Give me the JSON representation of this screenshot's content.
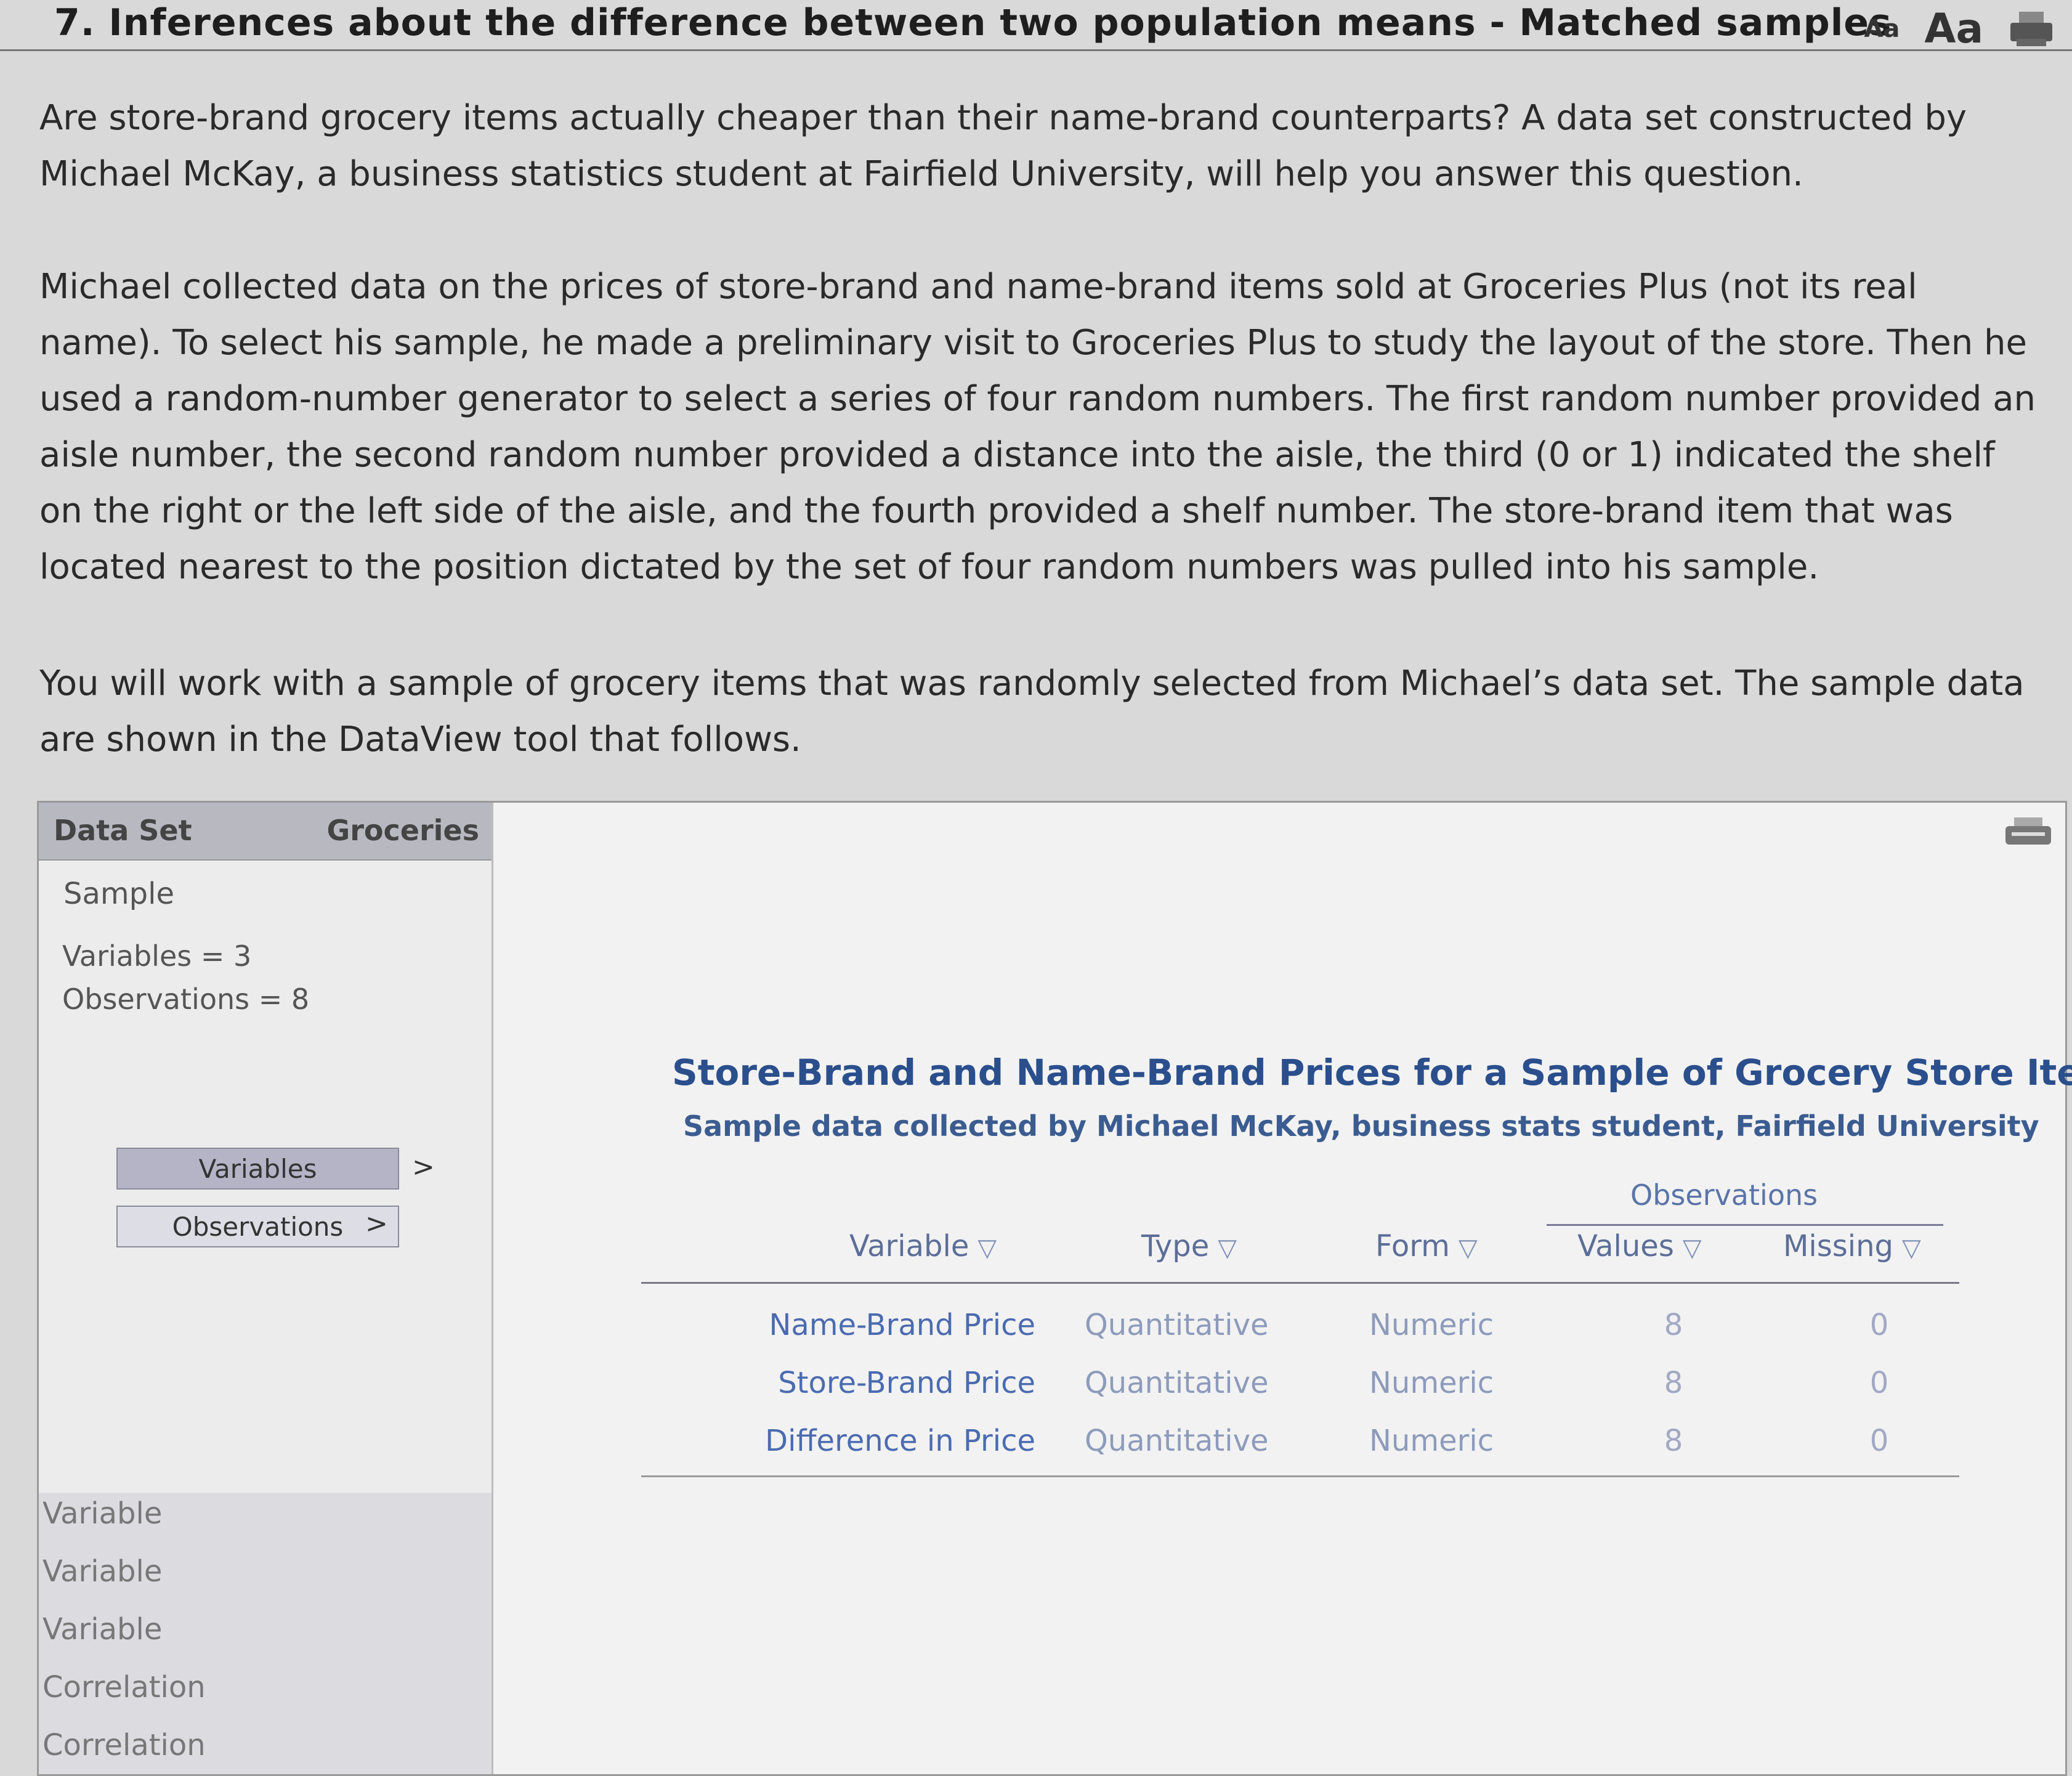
{
  "header": {
    "title": "7. Inferences about the difference between two population means - Matched samples",
    "font_small_label": "Aa",
    "font_large_label": "Aa",
    "print_icon": "printer-icon"
  },
  "intro": {
    "p1": "Are store-brand grocery items actually cheaper than their name-brand counterparts? A data set constructed by Michael McKay, a business statistics student at Fairfield University, will help you answer this question.",
    "p2": "Michael collected data on the prices of store-brand and name-brand items sold at Groceries Plus (not its real name). To select his sample, he made a preliminary visit to Groceries Plus to study the layout of the store. Then he used a random-number generator to select a series of four random numbers. The first random number provided an aisle number, the second random number provided a distance into the aisle, the third (0 or 1) indicated the shelf on the right or the left side of the aisle, and the fourth provided a shelf number. The store-brand item that was located nearest to the position dictated by the set of four random numbers was pulled into his sample.",
    "p3": "You will work with a sample of grocery items that was randomly selected from Michael’s data set. The sample data are shown in the DataView tool that follows."
  },
  "dataview": {
    "dataset_label": "Data Set",
    "dataset_value": "Groceries",
    "sample_label": "Sample",
    "variables_count": "Variables = 3",
    "observations_count": "Observations = 8",
    "variables_button": "Variables",
    "observations_button": "Observations",
    "arrow": ">",
    "side_items": [
      "Variable",
      "Variable",
      "Variable",
      "Correlation",
      "Correlation"
    ],
    "print_icon": "printer-icon",
    "table": {
      "title": "Store-Brand and Name-Brand Prices for a Sample of Grocery Store Items",
      "subtitle": "Sample data collected by Michael McKay, business stats student, Fairfield University",
      "observations_group": "Observations",
      "columns": {
        "variable": "Variable",
        "type": "Type",
        "form": "Form",
        "values": "Values",
        "missing": "Missing"
      },
      "sort_glyph": "▽",
      "rows": [
        {
          "variable": "Name-Brand Price",
          "type": "Quantitative",
          "form": "Numeric",
          "values": "8",
          "missing": "0"
        },
        {
          "variable": "Store-Brand Price",
          "type": "Quantitative",
          "form": "Numeric",
          "values": "8",
          "missing": "0"
        },
        {
          "variable": "Difference in Price",
          "type": "Quantitative",
          "form": "Numeric",
          "values": "8",
          "missing": "0"
        }
      ]
    }
  }
}
